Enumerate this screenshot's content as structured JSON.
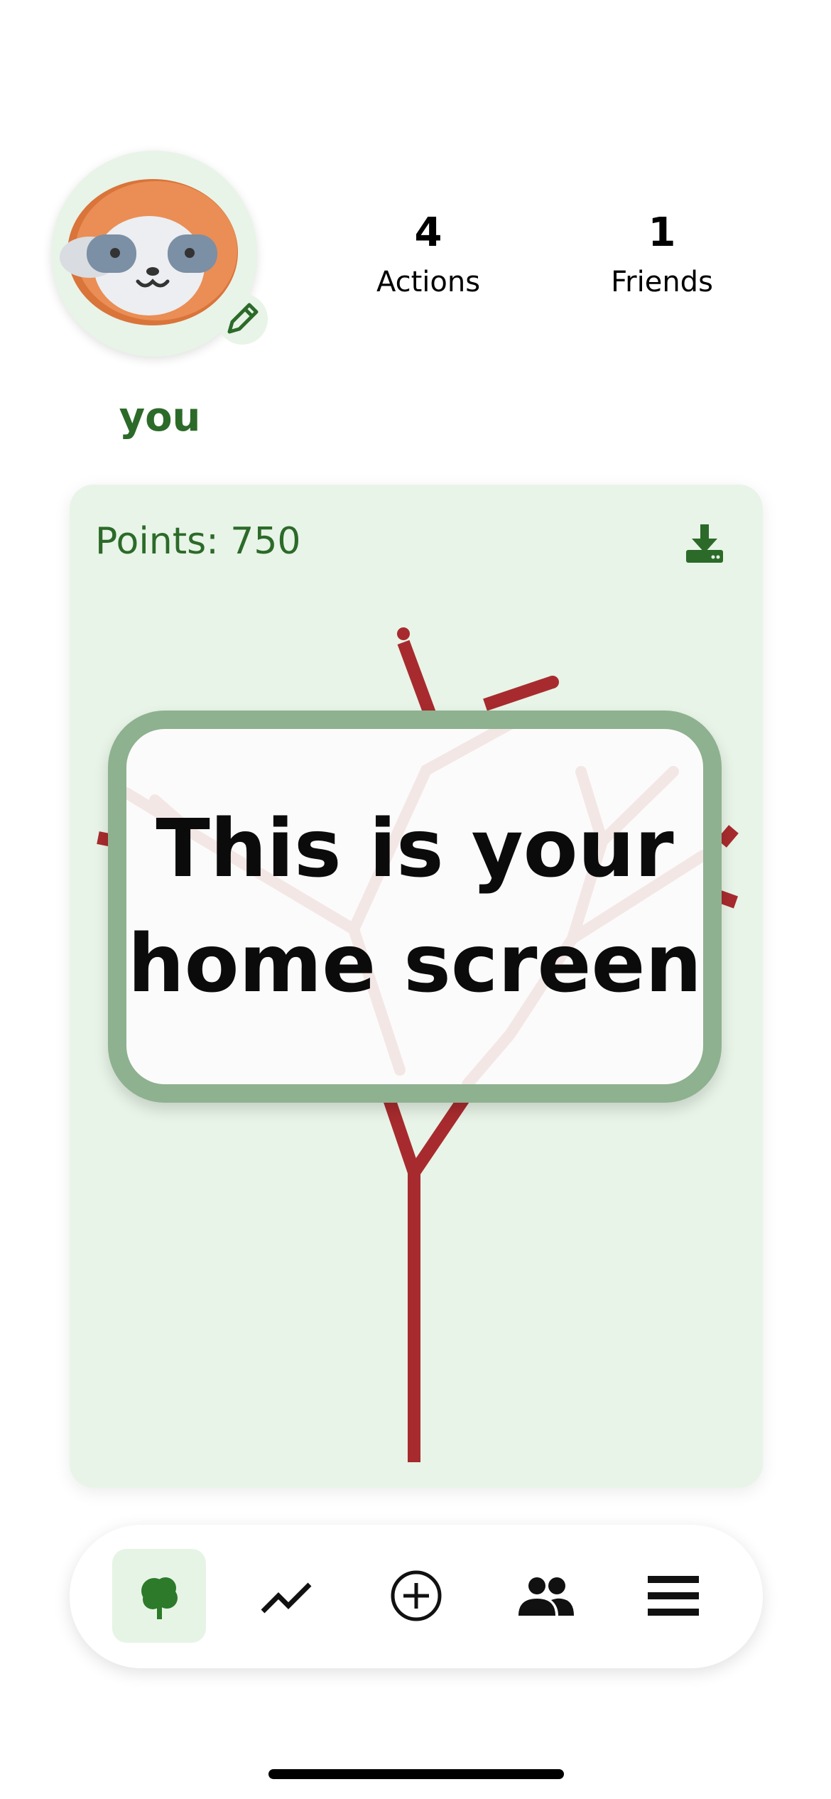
{
  "profile": {
    "username": "you",
    "stats": [
      {
        "value": "4",
        "label": "Actions"
      },
      {
        "value": "1",
        "label": "Friends"
      }
    ],
    "avatar_icon": "sloth-avatar-icon",
    "edit_icon": "pencil-icon"
  },
  "tree_card": {
    "points_label": "Points: 750",
    "download_icon": "download-icon",
    "tree_color": "#a72b2e"
  },
  "overlay": {
    "line1": "This is your",
    "line2": "home screen"
  },
  "bottom_nav": {
    "items": [
      {
        "name": "tree-tab",
        "icon": "tree-icon",
        "active": true
      },
      {
        "name": "stats-tab",
        "icon": "trend-icon",
        "active": false
      },
      {
        "name": "add-tab",
        "icon": "plus-circle-icon",
        "active": false
      },
      {
        "name": "friends-tab",
        "icon": "people-icon",
        "active": false
      },
      {
        "name": "menu-tab",
        "icon": "menu-icon",
        "active": false
      }
    ]
  },
  "colors": {
    "brand_green": "#2c6a29",
    "card_background": "#e8f4e7",
    "overlay_border": "#8eb190"
  }
}
